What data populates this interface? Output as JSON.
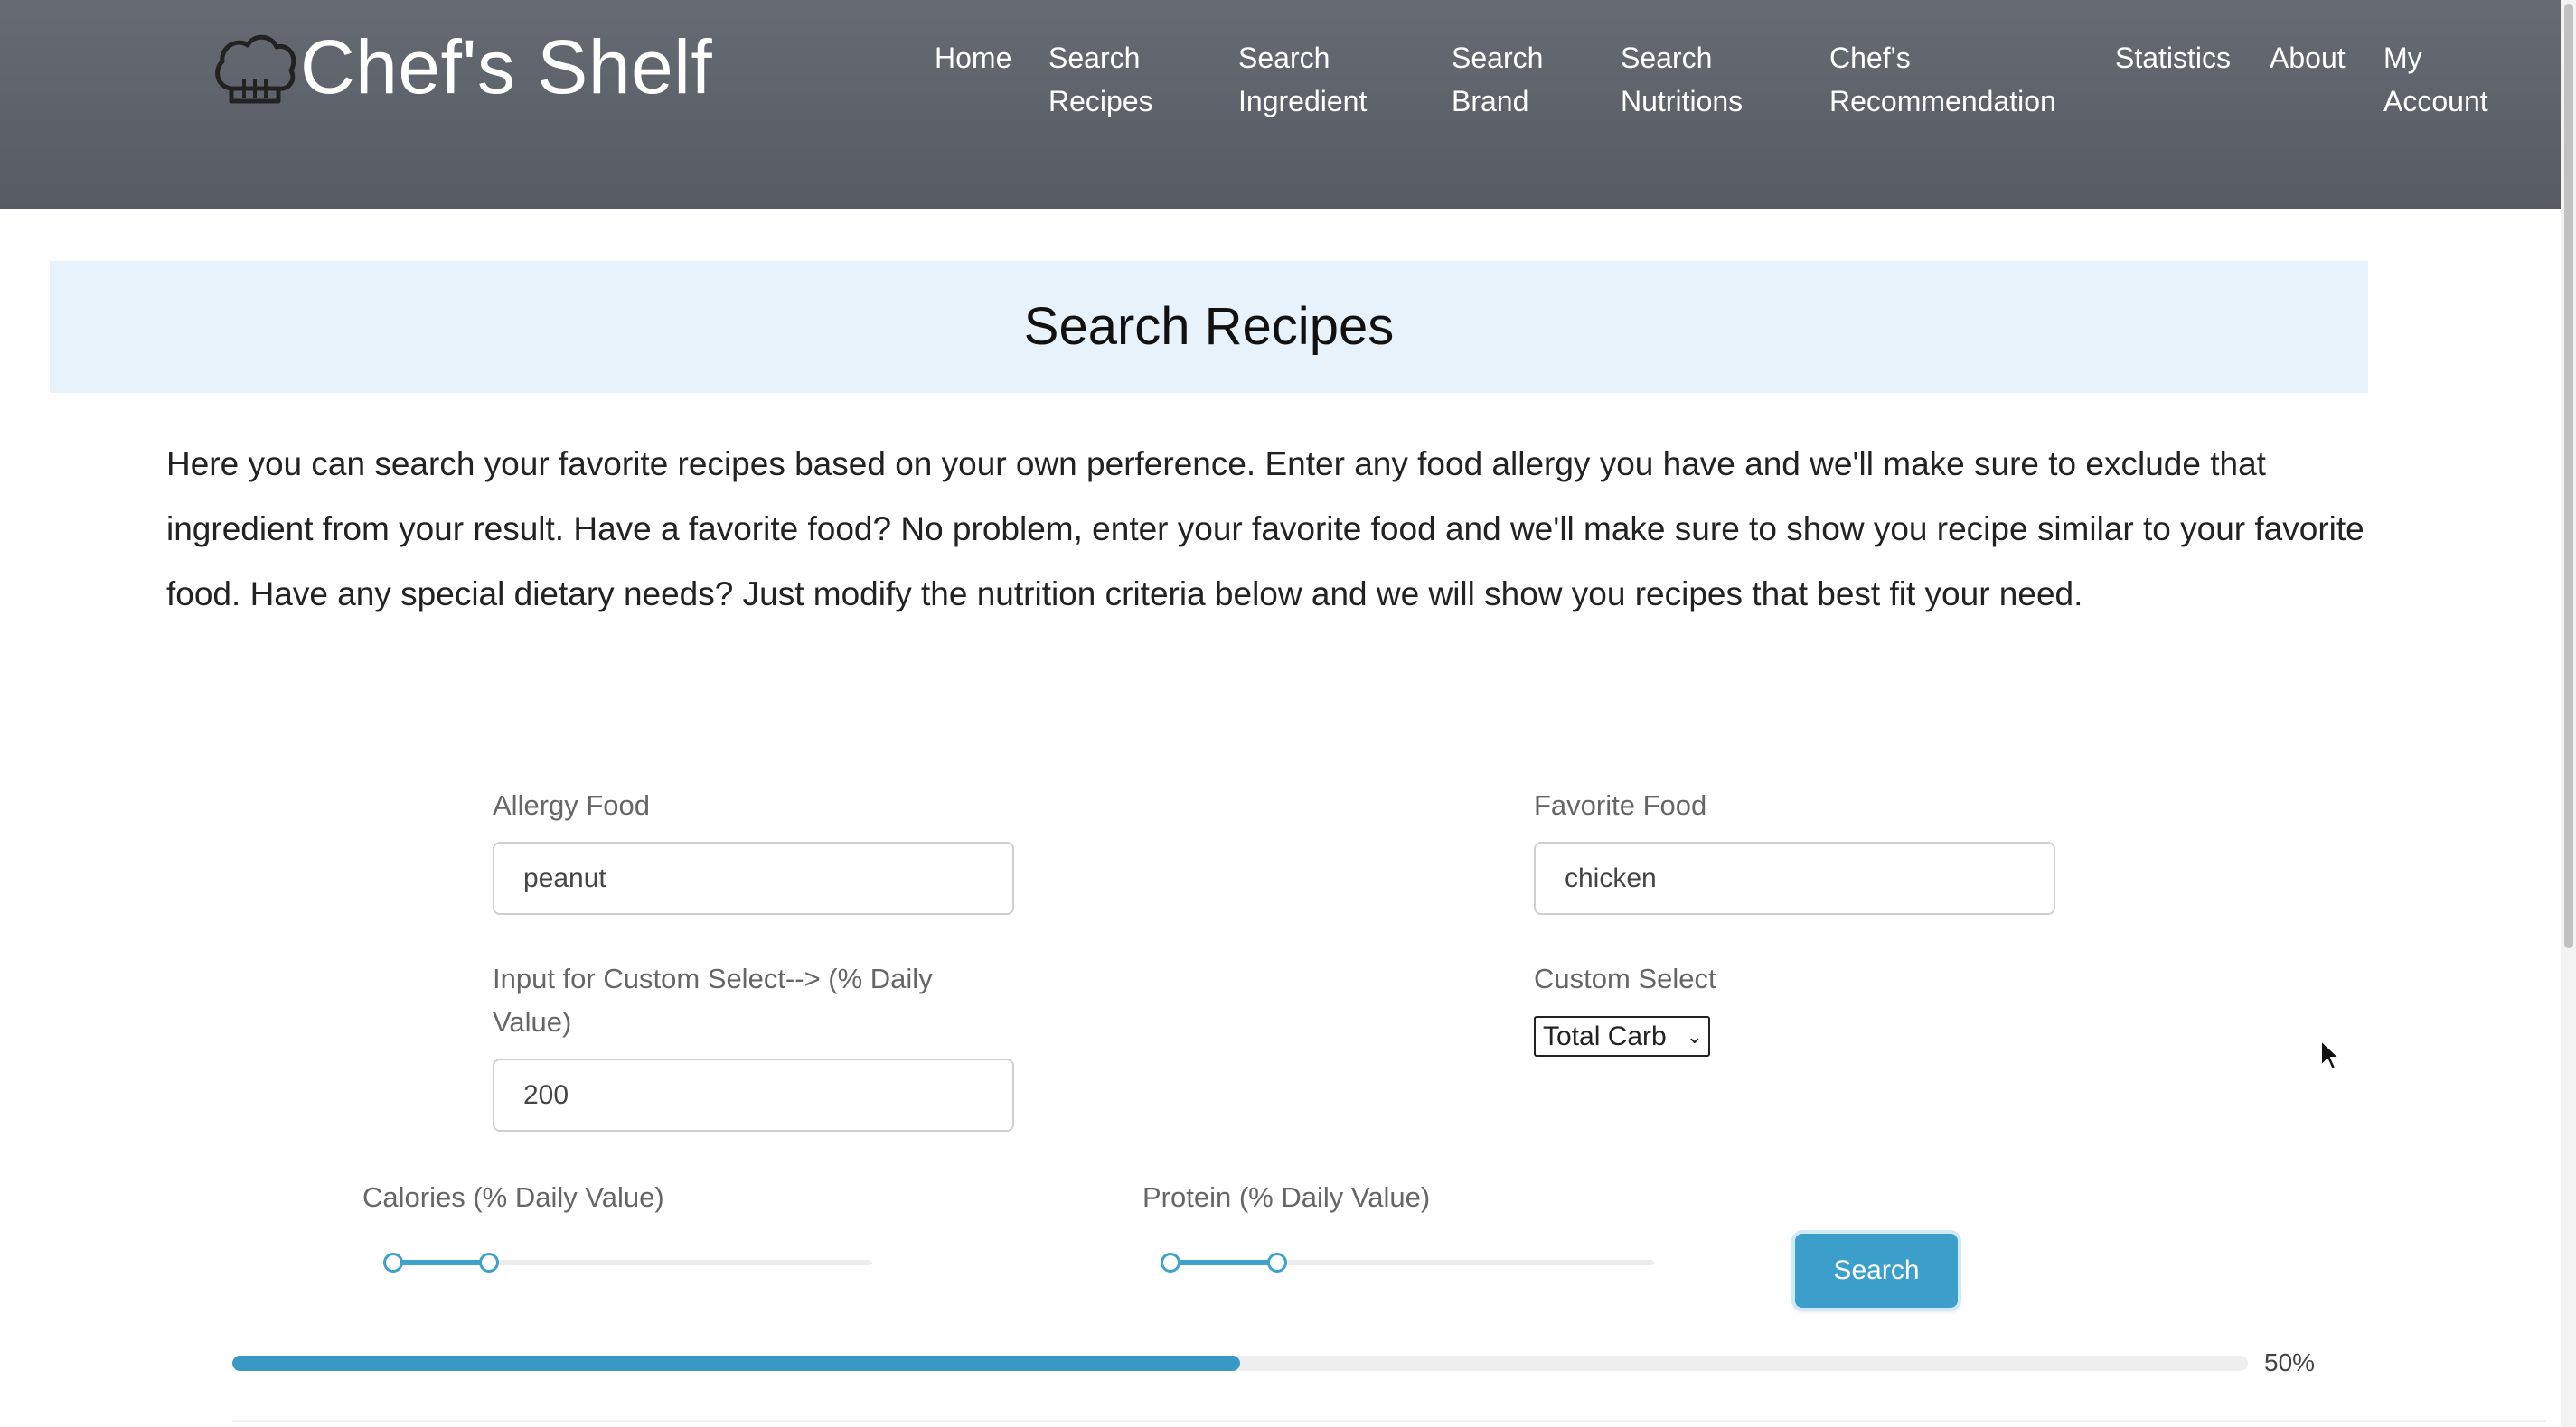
{
  "navbar": {
    "brand": "Chef's Shelf",
    "logo_icon": "chef-hat-icon",
    "items": [
      {
        "label": "Home"
      },
      {
        "label": "Search\nRecipes"
      },
      {
        "label": "Search\nIngredient"
      },
      {
        "label": "Search\nBrand"
      },
      {
        "label": "Search\nNutritions"
      },
      {
        "label": "Chef's\nRecommendation"
      },
      {
        "label": "Statistics"
      },
      {
        "label": "About"
      },
      {
        "label": "My\nAccount"
      }
    ]
  },
  "main": {
    "title": "Search Recipes",
    "description": "Here you can search your favorite recipes based on your own perference. Enter any food allergy you have and we'll make sure to exclude that ingredient from your result. Have a favorite food? No problem, enter your favorite food and we'll make sure to show you recipe similar to your favorite food. Have any special dietary needs? Just modify the nutrition criteria below and we will show you recipes that best fit your need."
  },
  "form": {
    "allergy": {
      "label": "Allergy Food",
      "value": "peanut"
    },
    "favorite": {
      "label": "Favorite Food",
      "value": "chicken"
    },
    "custom_input": {
      "label": "Input for Custom Select--> (% Daily Value)",
      "value": "200"
    },
    "custom_select": {
      "label": "Custom Select",
      "selected": "Total Carb"
    },
    "calories_slider": {
      "label": "Calories (% Daily Value)",
      "range": [
        0,
        0.2
      ]
    },
    "protein_slider": {
      "label": "Protein (% Daily Value)",
      "range": [
        0,
        0.22
      ]
    },
    "search_button": "Search"
  },
  "progress": {
    "value": 0.5,
    "label": "50%"
  },
  "colors": {
    "navbar_bg": "#5f636b",
    "accent": "#3c9fcb",
    "title_banner": "#e7f2fb"
  }
}
